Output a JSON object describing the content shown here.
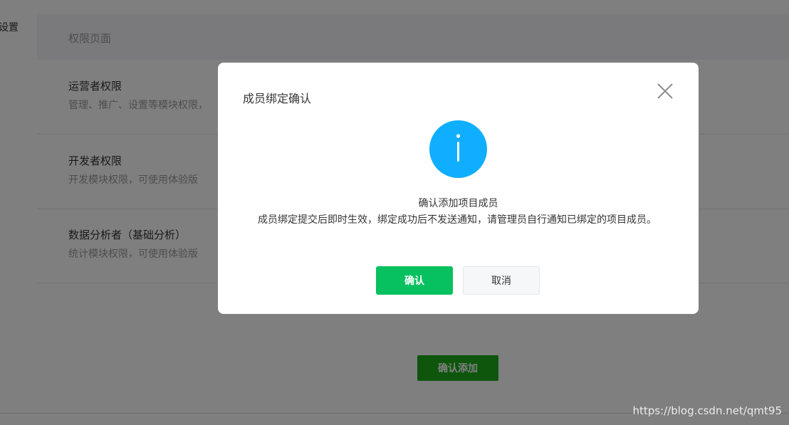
{
  "background": {
    "side_label": "设置",
    "permission_header": "权限页面",
    "permissions": [
      {
        "title": "运营者权限",
        "desc": "管理、推广、设置等模块权限，"
      },
      {
        "title": "开发者权限",
        "desc": "开发模块权限，可使用体验版"
      },
      {
        "title": "数据分析者（基础分析）",
        "desc": "统计模块权限，可使用体验版"
      }
    ],
    "confirm_add_button": "确认添加"
  },
  "dialog": {
    "title": "成员绑定确认",
    "icon": "info-icon",
    "message_title": "确认添加项目成员",
    "message_body": "成员绑定提交后即时生效，绑定成功后不发送通知，请管理员自行通知已绑定的项目成员。",
    "confirm_label": "确认",
    "cancel_label": "取消"
  },
  "watermark": "https://blog.csdn.net/qmt95",
  "colors": {
    "primary_green": "#07c160",
    "info_blue": "#10aeff",
    "background_button_green": "#1aad19"
  }
}
